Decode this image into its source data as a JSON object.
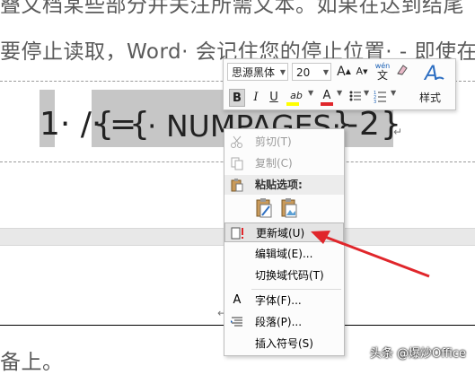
{
  "document": {
    "line1": "叠文档某些部分并关注所需文本。如果在达到结尾",
    "line2": "要停止读取，Word· 会记住您的停止位置· - 即使在",
    "bottom_line": "备上。",
    "field_prefix": "1· /·",
    "field_brace_open": "{",
    "field_eq": "=",
    "field_brace_inner": "{",
    "field_code": "· NUMPAGES·",
    "field_close_inner": "}",
    "field_minus": "-",
    "field_two": "2",
    "field_close": "}",
    "para_mark": "↵"
  },
  "mini_toolbar": {
    "font_name": "思源黑体",
    "font_size": "20",
    "grow_font": "A",
    "shrink_font": "A",
    "phonetic_guide": "wén",
    "phonetic_char": "文",
    "bold": "B",
    "italic": "I",
    "underline": "U",
    "highlight": "ab",
    "font_color": "A",
    "styles_icon_label": "A",
    "styles_label": "样式"
  },
  "context_menu": {
    "items": [
      {
        "label": "剪切(T)",
        "state": "disabled"
      },
      {
        "label": "复制(C)",
        "state": "disabled"
      },
      {
        "label": "粘贴选项:",
        "state": "header"
      },
      {
        "label": "更新域(U)",
        "state": "highlighted"
      },
      {
        "label": "编辑域(E)...",
        "state": "normal"
      },
      {
        "label": "切换域代码(T)",
        "state": "normal"
      },
      {
        "label": "字体(F)...",
        "state": "normal"
      },
      {
        "label": "段落(P)...",
        "state": "normal"
      },
      {
        "label": "插入符号(S)",
        "state": "normal"
      }
    ]
  },
  "watermark": {
    "text": "头条 @爆炒Office"
  },
  "colors": {
    "accent_red": "#e0262b",
    "field_shade": "#c6c6c6",
    "highlight_yellow": "#ffff00",
    "font_red": "#e0262b"
  }
}
